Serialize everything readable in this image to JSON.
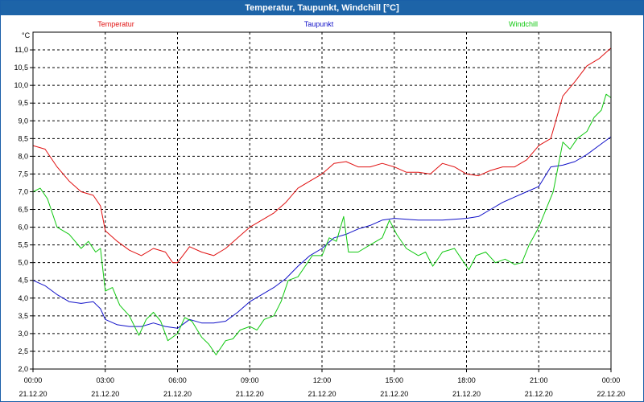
{
  "window": {
    "title": "Temperatur, Taupunkt, Windchill [°C]"
  },
  "chart_data": {
    "type": "line",
    "title": "Temperatur, Taupunkt, Windchill [°C]",
    "ylabel": "°C",
    "xlabel": "",
    "ylim": [
      2.0,
      11.5
    ],
    "xlim_hours": [
      0,
      24
    ],
    "grid": true,
    "legend_position": "top",
    "y_ticks": [
      "2,0",
      "2,5",
      "3,0",
      "3,5",
      "4,0",
      "4,5",
      "5,0",
      "5,5",
      "6,0",
      "6,5",
      "7,0",
      "7,5",
      "8,0",
      "8,5",
      "9,0",
      "9,5",
      "10,0",
      "10,5",
      "11,0"
    ],
    "x_ticks": [
      {
        "time": "00:00",
        "date": "21.12.20"
      },
      {
        "time": "03:00",
        "date": "21.12.20"
      },
      {
        "time": "06:00",
        "date": "21.12.20"
      },
      {
        "time": "09:00",
        "date": "21.12.20"
      },
      {
        "time": "12:00",
        "date": "21.12.20"
      },
      {
        "time": "15:00",
        "date": "21.12.20"
      },
      {
        "time": "18:00",
        "date": "21.12.20"
      },
      {
        "time": "21:00",
        "date": "21.12.20"
      },
      {
        "time": "00:00",
        "date": "22.12.20"
      }
    ],
    "series": [
      {
        "name": "Temperatur",
        "color": "#e01010",
        "points": [
          [
            0,
            8.3
          ],
          [
            0.5,
            8.2
          ],
          [
            1,
            7.7
          ],
          [
            1.5,
            7.3
          ],
          [
            2,
            7.0
          ],
          [
            2.5,
            6.9
          ],
          [
            2.8,
            6.6
          ],
          [
            3,
            5.9
          ],
          [
            3.5,
            5.6
          ],
          [
            4,
            5.35
          ],
          [
            4.5,
            5.2
          ],
          [
            5,
            5.4
          ],
          [
            5.5,
            5.3
          ],
          [
            5.8,
            5.0
          ],
          [
            6,
            5.0
          ],
          [
            6.5,
            5.45
          ],
          [
            7,
            5.3
          ],
          [
            7.5,
            5.2
          ],
          [
            8,
            5.4
          ],
          [
            8.5,
            5.7
          ],
          [
            9,
            6.0
          ],
          [
            9.5,
            6.2
          ],
          [
            10,
            6.4
          ],
          [
            10.5,
            6.7
          ],
          [
            11,
            7.1
          ],
          [
            11.5,
            7.3
          ],
          [
            12,
            7.5
          ],
          [
            12.5,
            7.8
          ],
          [
            13,
            7.85
          ],
          [
            13.5,
            7.7
          ],
          [
            14,
            7.7
          ],
          [
            14.5,
            7.8
          ],
          [
            15,
            7.7
          ],
          [
            15.5,
            7.55
          ],
          [
            16,
            7.55
          ],
          [
            16.5,
            7.5
          ],
          [
            17,
            7.8
          ],
          [
            17.5,
            7.7
          ],
          [
            18,
            7.5
          ],
          [
            18.5,
            7.45
          ],
          [
            19,
            7.6
          ],
          [
            19.5,
            7.7
          ],
          [
            20,
            7.7
          ],
          [
            20.5,
            7.9
          ],
          [
            21,
            8.3
          ],
          [
            21.5,
            8.5
          ],
          [
            22,
            9.7
          ],
          [
            22.5,
            10.1
          ],
          [
            23,
            10.55
          ],
          [
            23.5,
            10.75
          ],
          [
            24,
            11.05
          ]
        ]
      },
      {
        "name": "Taupunkt",
        "color": "#1010c8",
        "points": [
          [
            0,
            4.5
          ],
          [
            0.5,
            4.35
          ],
          [
            1,
            4.1
          ],
          [
            1.5,
            3.9
          ],
          [
            2,
            3.85
          ],
          [
            2.5,
            3.9
          ],
          [
            2.8,
            3.7
          ],
          [
            3,
            3.4
          ],
          [
            3.5,
            3.25
          ],
          [
            4,
            3.2
          ],
          [
            4.5,
            3.2
          ],
          [
            5,
            3.3
          ],
          [
            5.5,
            3.2
          ],
          [
            6,
            3.15
          ],
          [
            6.5,
            3.4
          ],
          [
            7,
            3.3
          ],
          [
            7.5,
            3.3
          ],
          [
            8,
            3.35
          ],
          [
            8.5,
            3.6
          ],
          [
            9,
            3.9
          ],
          [
            9.5,
            4.1
          ],
          [
            10,
            4.3
          ],
          [
            10.5,
            4.55
          ],
          [
            11,
            4.9
          ],
          [
            11.5,
            5.2
          ],
          [
            12,
            5.4
          ],
          [
            12.5,
            5.7
          ],
          [
            13,
            5.8
          ],
          [
            13.5,
            5.95
          ],
          [
            14,
            6.05
          ],
          [
            14.5,
            6.2
          ],
          [
            15,
            6.25
          ],
          [
            16,
            6.2
          ],
          [
            17,
            6.2
          ],
          [
            18,
            6.25
          ],
          [
            18.5,
            6.3
          ],
          [
            19,
            6.5
          ],
          [
            19.5,
            6.7
          ],
          [
            20,
            6.85
          ],
          [
            20.5,
            7.0
          ],
          [
            21,
            7.15
          ],
          [
            21.5,
            7.7
          ],
          [
            22,
            7.75
          ],
          [
            22.5,
            7.85
          ],
          [
            23,
            8.05
          ],
          [
            23.5,
            8.3
          ],
          [
            24,
            8.55
          ]
        ]
      },
      {
        "name": "Windchill",
        "color": "#10c810",
        "points": [
          [
            0,
            7.0
          ],
          [
            0.3,
            7.1
          ],
          [
            0.6,
            6.8
          ],
          [
            1,
            6.0
          ],
          [
            1.5,
            5.8
          ],
          [
            2,
            5.4
          ],
          [
            2.3,
            5.6
          ],
          [
            2.6,
            5.3
          ],
          [
            2.8,
            5.4
          ],
          [
            3,
            4.2
          ],
          [
            3.3,
            4.3
          ],
          [
            3.6,
            3.8
          ],
          [
            4,
            3.5
          ],
          [
            4.4,
            2.95
          ],
          [
            4.7,
            3.4
          ],
          [
            5,
            3.6
          ],
          [
            5.3,
            3.35
          ],
          [
            5.6,
            2.8
          ],
          [
            6,
            3.0
          ],
          [
            6.3,
            3.45
          ],
          [
            6.6,
            3.35
          ],
          [
            7,
            2.9
          ],
          [
            7.3,
            2.7
          ],
          [
            7.6,
            2.4
          ],
          [
            8,
            2.8
          ],
          [
            8.3,
            2.85
          ],
          [
            8.6,
            3.1
          ],
          [
            9,
            3.2
          ],
          [
            9.3,
            3.1
          ],
          [
            9.6,
            3.4
          ],
          [
            10,
            3.5
          ],
          [
            10.3,
            3.9
          ],
          [
            10.6,
            4.5
          ],
          [
            11,
            4.6
          ],
          [
            11.3,
            4.9
          ],
          [
            11.6,
            5.2
          ],
          [
            12,
            5.2
          ],
          [
            12.3,
            5.7
          ],
          [
            12.6,
            5.6
          ],
          [
            12.9,
            6.3
          ],
          [
            13.1,
            5.3
          ],
          [
            13.5,
            5.3
          ],
          [
            14,
            5.5
          ],
          [
            14.5,
            5.7
          ],
          [
            14.8,
            6.2
          ],
          [
            15.1,
            5.8
          ],
          [
            15.5,
            5.4
          ],
          [
            16,
            5.2
          ],
          [
            16.3,
            5.3
          ],
          [
            16.6,
            4.9
          ],
          [
            17,
            5.3
          ],
          [
            17.5,
            5.4
          ],
          [
            17.8,
            5.1
          ],
          [
            18.1,
            4.8
          ],
          [
            18.4,
            5.2
          ],
          [
            18.8,
            5.3
          ],
          [
            19.2,
            5.0
          ],
          [
            19.6,
            5.1
          ],
          [
            20,
            4.95
          ],
          [
            20.3,
            5.0
          ],
          [
            20.6,
            5.5
          ],
          [
            21,
            6.0
          ],
          [
            21.3,
            6.5
          ],
          [
            21.6,
            7.0
          ],
          [
            22,
            8.4
          ],
          [
            22.3,
            8.2
          ],
          [
            22.6,
            8.5
          ],
          [
            23,
            8.7
          ],
          [
            23.3,
            9.1
          ],
          [
            23.6,
            9.3
          ],
          [
            23.8,
            9.75
          ],
          [
            24,
            9.65
          ]
        ]
      }
    ]
  }
}
